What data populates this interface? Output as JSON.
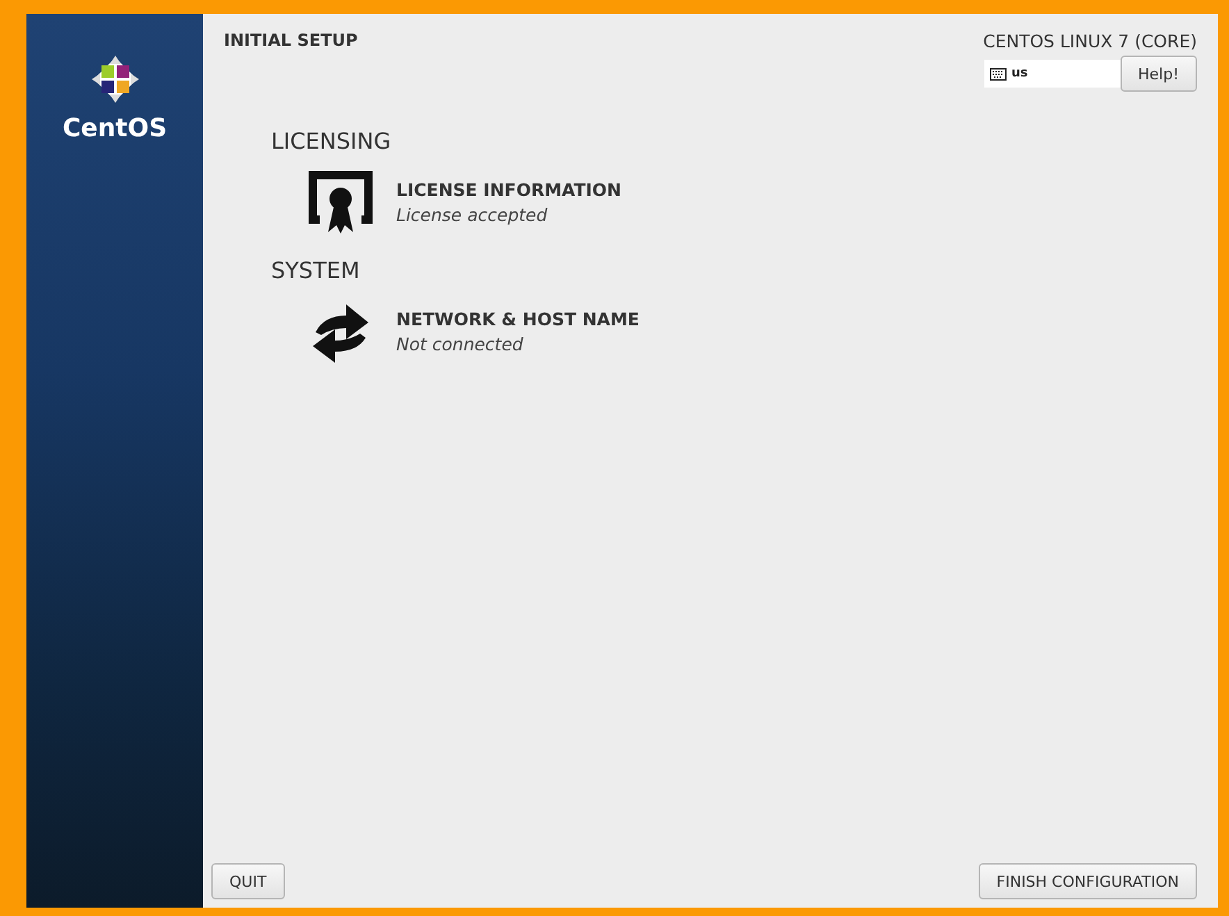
{
  "sidebar": {
    "logo_text": "CentOS"
  },
  "header": {
    "title": "INITIAL SETUP",
    "product": "CENTOS LINUX 7 (CORE)",
    "keyboard_layout": "us",
    "help_button": "Help!"
  },
  "sections": [
    {
      "title": "LICENSING",
      "items": [
        {
          "kind": "license",
          "title": "LICENSE INFORMATION",
          "status": "License accepted"
        }
      ]
    },
    {
      "title": "SYSTEM",
      "items": [
        {
          "kind": "network",
          "title": "NETWORK & HOST NAME",
          "status": "Not connected"
        }
      ]
    }
  ],
  "footer": {
    "quit_button": "QUIT",
    "finish_button": "FINISH CONFIGURATION"
  }
}
